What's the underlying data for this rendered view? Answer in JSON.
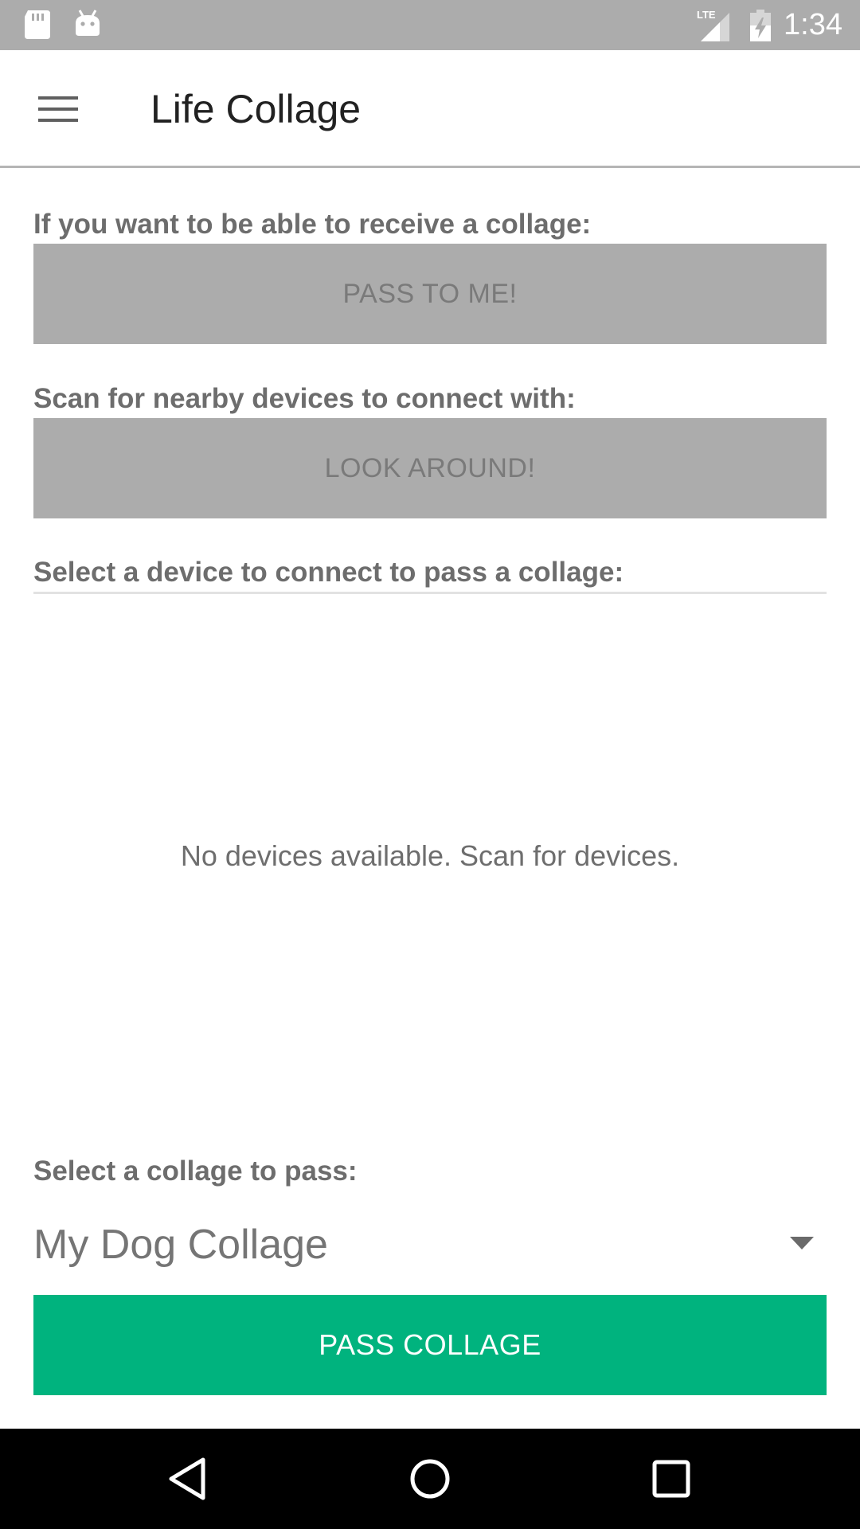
{
  "status_bar": {
    "time": "1:34",
    "network": "LTE",
    "icons": [
      "sd-card-icon",
      "android-icon",
      "lte-signal-icon",
      "battery-charging-icon"
    ]
  },
  "app_bar": {
    "menu_icon": "hamburger-menu-icon",
    "title": "Life Collage"
  },
  "receive_section": {
    "label": "If you want to be able to receive a collage:",
    "button_label": "PASS TO ME!"
  },
  "scan_section": {
    "label": "Scan for nearby devices to connect with:",
    "button_label": "LOOK AROUND!"
  },
  "devices_section": {
    "label": "Select a device to connect to pass a collage:",
    "empty_message": "No devices available. Scan for devices."
  },
  "collage_section": {
    "label": "Select a collage to pass:",
    "selected_collage": "My Dog Collage",
    "dropdown_icon": "dropdown-arrow-icon"
  },
  "pass_button": {
    "label": "PASS COLLAGE"
  },
  "nav_bar": {
    "icons": [
      "back-icon",
      "home-icon",
      "recents-icon"
    ]
  },
  "colors": {
    "status_bar": "#acacac",
    "disabled_button": "#acacac",
    "accent": "#00b37e",
    "label_text": "#6d6d6d"
  }
}
